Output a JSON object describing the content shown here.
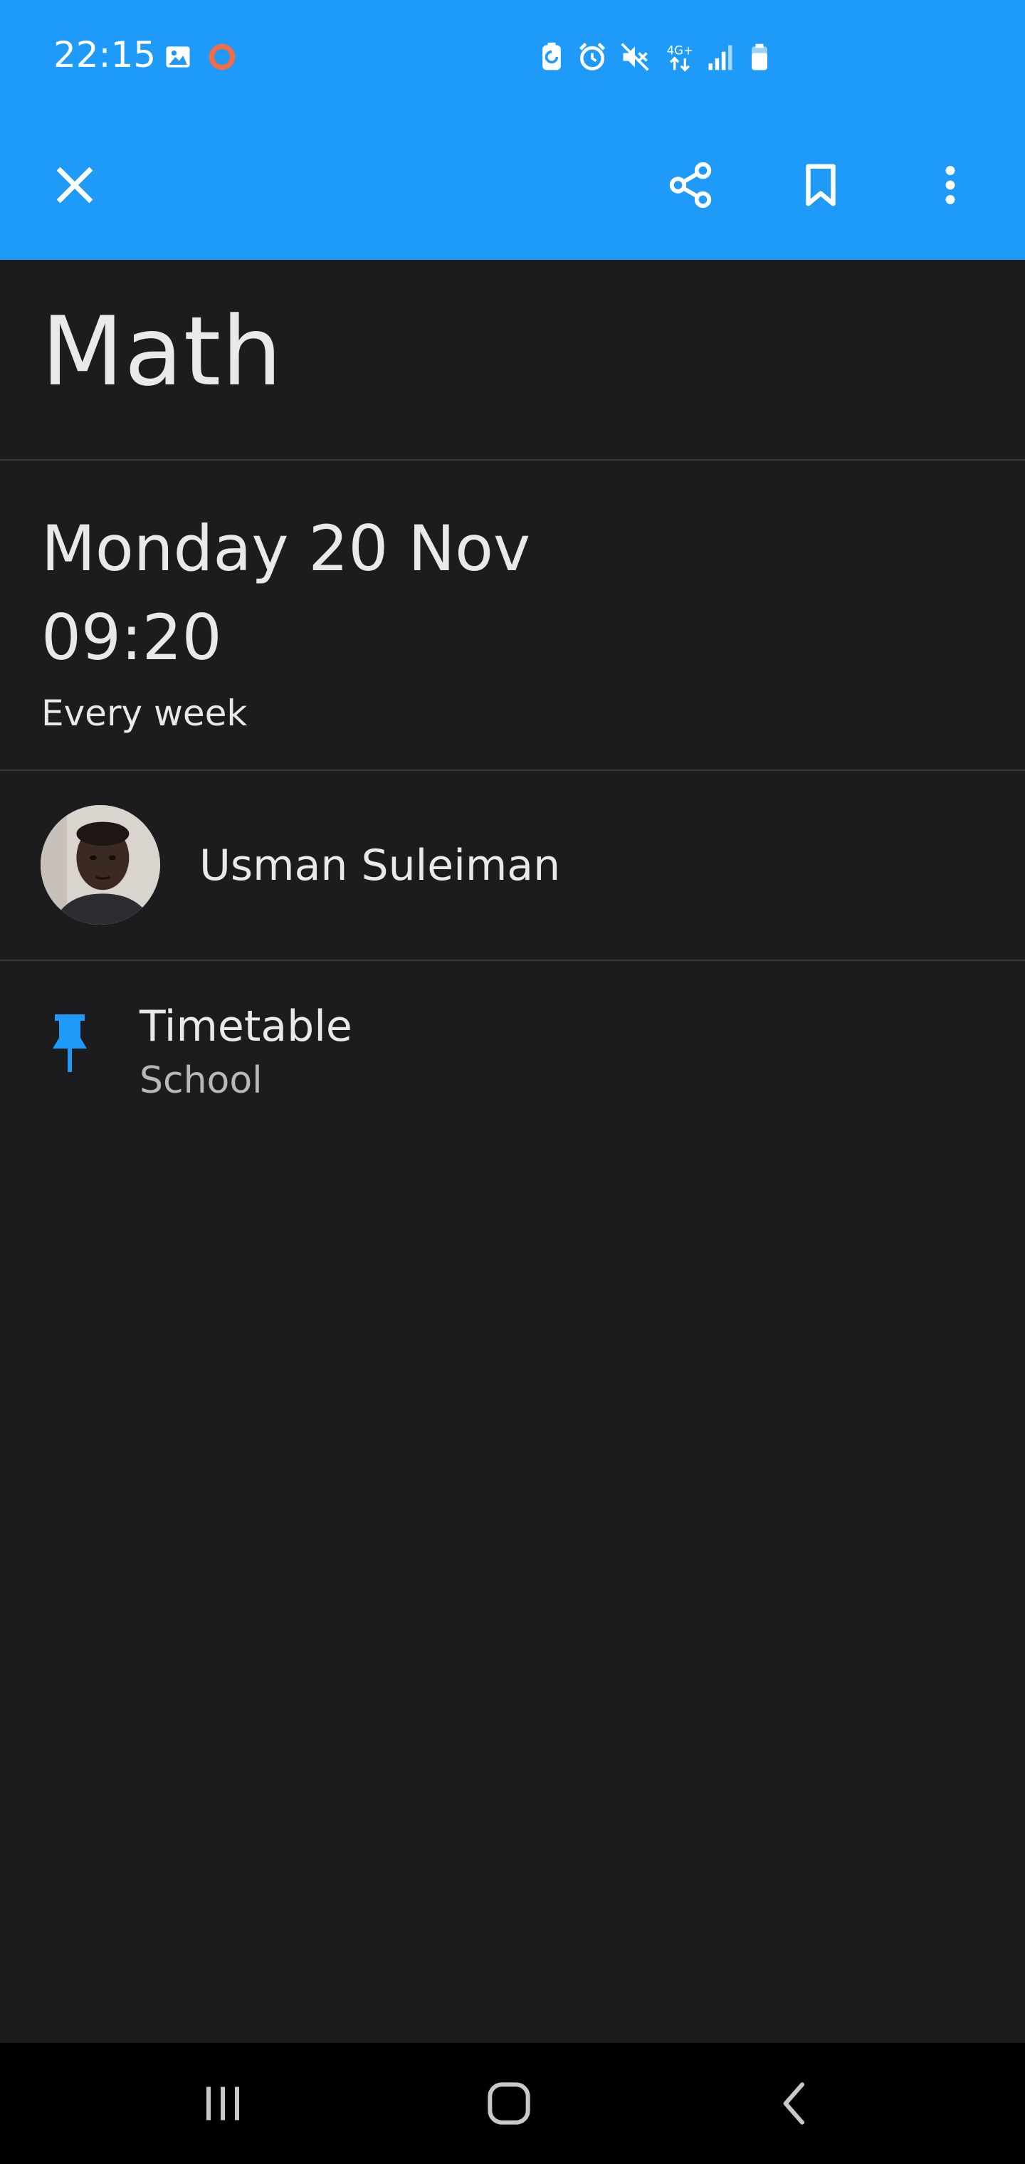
{
  "status_bar": {
    "time": "22:15",
    "icons": [
      "gallery-icon",
      "record-icon",
      "battery-saver-icon",
      "alarm-icon",
      "mute-icon",
      "network-4g-icon",
      "signal-icon",
      "battery-icon"
    ]
  },
  "app_bar": {
    "close_icon": "close-icon",
    "share_icon": "share-icon",
    "bookmark_icon": "bookmark-icon",
    "more_icon": "more-vertical-icon"
  },
  "event": {
    "title": "Math",
    "date": "Monday 20 Nov",
    "time": "09:20",
    "repeat": "Every week"
  },
  "organizer": {
    "name": "Usman Suleiman"
  },
  "calendar": {
    "name": "Timetable",
    "account": "School",
    "icon": "pin-icon"
  },
  "colors": {
    "header_bg": "#1e9bf8",
    "content_bg": "#1c1c1e",
    "accent": "#1e9bf8",
    "record_dot": "#f26b4a"
  },
  "nav_bar": {
    "icons": [
      "recent-apps-icon",
      "home-icon",
      "back-icon"
    ]
  }
}
